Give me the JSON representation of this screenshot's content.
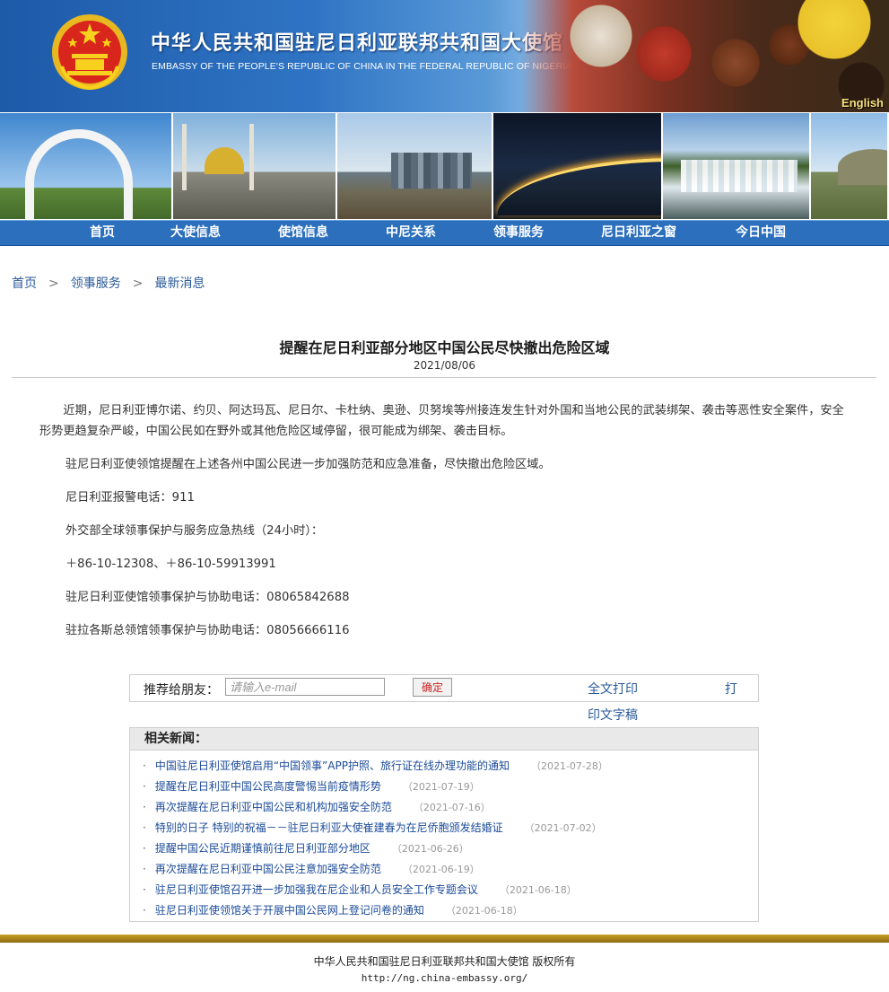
{
  "header": {
    "title_cn": "中华人民共和国驻尼日利亚联邦共和国大使馆",
    "title_en": "EMBASSY OF THE PEOPLE'S REPUBLIC OF CHINA IN THE FEDERAL REPUBLIC OF NIGERIA",
    "english_link": "English"
  },
  "nav": {
    "items": [
      "首页",
      "大使信息",
      "使馆信息",
      "中尼关系",
      "领事服务",
      "尼日利亚之窗",
      "今日中国"
    ]
  },
  "breadcrumb": {
    "items": [
      "首页",
      "领事服务",
      "最新消息"
    ],
    "separator": ">"
  },
  "article": {
    "title": "提醒在尼日利亚部分地区中国公民尽快撤出危险区域",
    "date": "2021/08/06",
    "p1": "近期，尼日利亚博尔诺、约贝、阿达玛瓦、尼日尔、卡杜纳、奥逊、贝努埃等州接连发生针对外国和当地公民的武装绑架、袭击等恶性安全案件，安全形势更趋复杂严峻，中国公民如在野外或其他危险区域停留，很可能成为绑架、袭击目标。",
    "p2": "驻尼日利亚使领馆提醒在上述各州中国公民进一步加强防范和应急准备，尽快撤出危险区域。",
    "p3": "尼日利亚报警电话：911",
    "p4": "外交部全球领事保护与服务应急热线（24小时）：",
    "p5": "＋86-10-12308、＋86-10-59913991",
    "p6": "驻尼日利亚使馆领事保护与协助电话：08065842688",
    "p7": "驻拉各斯总领馆领事保护与协助电话：08056666116"
  },
  "share": {
    "label": "推荐给朋友：",
    "placeholder": "请输入e-mail",
    "submit": "确定",
    "print_label_1": "全文打印",
    "print_label_2": "印文字稿",
    "extra": "打"
  },
  "related": {
    "heading": "相关新闻：",
    "items": [
      {
        "title": "中国驻尼日利亚使馆启用“中国领事”APP护照、旅行证在线办理功能的通知",
        "date": "（2021-07-28）"
      },
      {
        "title": "提醒在尼日利亚中国公民高度警惕当前疫情形势",
        "date": "（2021-07-19）"
      },
      {
        "title": "再次提醒在尼日利亚中国公民和机构加强安全防范",
        "date": "（2021-07-16）"
      },
      {
        "title": "特别的日子 特别的祝福－－驻尼日利亚大使崔建春为在尼侨胞颁发结婚证",
        "date": "（2021-07-02）"
      },
      {
        "title": "提醒中国公民近期谨慎前往尼日利亚部分地区",
        "date": "（2021-06-26）"
      },
      {
        "title": "再次提醒在尼日利亚中国公民注意加强安全防范",
        "date": "（2021-06-19）"
      },
      {
        "title": "驻尼日利亚使馆召开进一步加强我在尼企业和人员安全工作专题会议",
        "date": "（2021-06-18）"
      },
      {
        "title": "驻尼日利亚使领馆关于开展中国公民网上登记问卷的通知",
        "date": "（2021-06-18）"
      }
    ]
  },
  "footer": {
    "copyright": "中华人民共和国驻尼日利亚联邦共和国大使馆 版权所有",
    "url": "http://ng.china-embassy.org/"
  }
}
